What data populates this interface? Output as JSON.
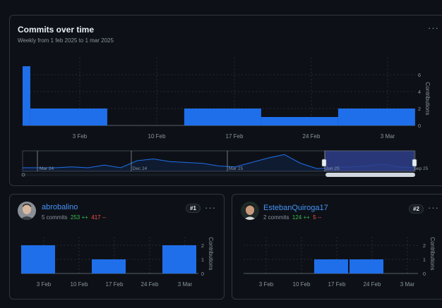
{
  "main": {
    "title": "Commits over time",
    "subtitle": "Weekly from 1 feb 2025 to 1 mar 2025",
    "menu_icon": "kebab-horizontal-icon"
  },
  "chart_data": [
    {
      "type": "bar",
      "ylabel": "Contributions",
      "yticks": [
        0,
        2,
        4,
        6
      ],
      "ylim": [
        0,
        8
      ],
      "xticks": [
        "3 Feb",
        "10 Feb",
        "17 Feb",
        "24 Feb",
        "3 Mar"
      ],
      "bars": [
        {
          "x0": 0,
          "x1": 1,
          "value": 7
        },
        {
          "x0": 1,
          "x1": 11,
          "value": 2
        },
        {
          "x0": 21,
          "x1": 31,
          "value": 2
        },
        {
          "x0": 31,
          "x1": 41,
          "value": 1
        },
        {
          "x0": 41,
          "x1": 51,
          "value": 2
        }
      ],
      "grid": true,
      "color": "#1f6feb"
    },
    {
      "type": "area",
      "role": "range-overview",
      "labels": [
        "Mar 24",
        "Dec 24",
        "Mar 25",
        "Jun 25",
        "Sep 25"
      ],
      "values": [
        0.2,
        0.2,
        0.2,
        0.25,
        0.2,
        0.35,
        0.2,
        0.6,
        0.7,
        0.55,
        0.5,
        0.45,
        0.3,
        0.25,
        0.5,
        0.75,
        0.95,
        0.45,
        0.15,
        0.2,
        0.25,
        0.3,
        0.4,
        0.25,
        0.2
      ],
      "selected_range": "last segment"
    },
    {
      "type": "bar",
      "ylabel": "Contributions",
      "yticks": [
        0,
        1,
        2
      ],
      "ylim": [
        0,
        2.6
      ],
      "xticks": [
        "3 Feb",
        "10 Feb",
        "17 Feb",
        "24 Feb",
        "3 Mar"
      ],
      "bars": [
        {
          "x0": 0,
          "x1": 1,
          "value": 2
        },
        {
          "x0": 2,
          "x1": 3,
          "value": 1
        },
        {
          "x0": 4,
          "x1": 5,
          "value": 2
        }
      ],
      "grid": true,
      "color": "#1f6feb"
    },
    {
      "type": "bar",
      "ylabel": "Contributions",
      "yticks": [
        0,
        1,
        2
      ],
      "ylim": [
        0,
        2.6
      ],
      "xticks": [
        "3 Feb",
        "10 Feb",
        "17 Feb",
        "24 Feb",
        "3 Mar"
      ],
      "bars": [
        {
          "x0": 2,
          "x1": 3,
          "value": 1
        },
        {
          "x0": 3,
          "x1": 4,
          "value": 1
        }
      ],
      "grid": true,
      "color": "#1f6feb"
    }
  ],
  "contributors": [
    {
      "name": "abrobalino",
      "commits": "5 commits",
      "additions": "253 ++",
      "deletions": "417 --",
      "rank": "#1",
      "avatar_icon": "user-avatar-icon"
    },
    {
      "name": "EstebanQuiroga17",
      "commits": "2 commits",
      "additions": "124 ++",
      "deletions": "5 --",
      "rank": "#2",
      "avatar_icon": "user-avatar-icon"
    }
  ],
  "colors": {
    "bar": "#1f6feb",
    "link": "#4493f8",
    "add": "#3fb950",
    "del": "#f85149"
  }
}
